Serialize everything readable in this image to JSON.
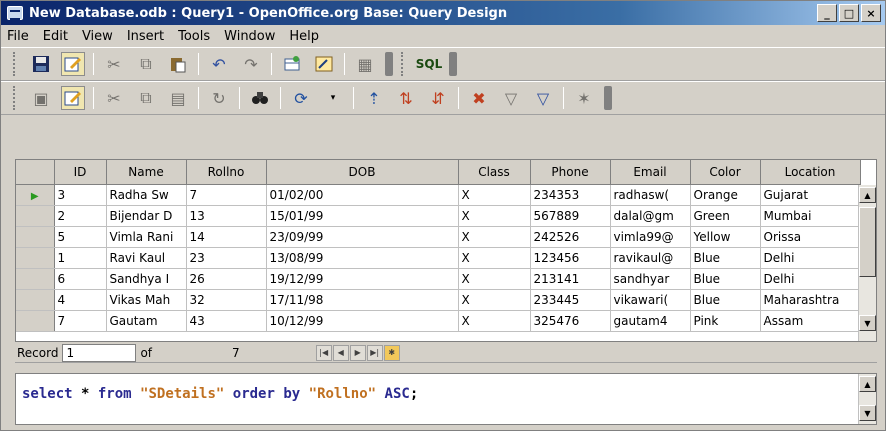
{
  "window": {
    "title": "New Database.odb : Query1 - OpenOffice.org Base: Query Design",
    "buttons": {
      "minimize": "_",
      "maximize": "□",
      "close": "×"
    }
  },
  "menu": [
    "File",
    "Edit",
    "View",
    "Insert",
    "Tools",
    "Window",
    "Help"
  ],
  "toolbar1": {
    "sql_label": "SQL"
  },
  "grid": {
    "columns": [
      "ID",
      "Name",
      "Rollno",
      "DOB",
      "Class",
      "Phone",
      "Email",
      "Color",
      "Location"
    ],
    "rows": [
      [
        "3",
        "Radha Sw",
        "7",
        "01/02/00",
        "X",
        "234353",
        "radhasw(",
        "Orange",
        "Gujarat"
      ],
      [
        "2",
        "Bijendar D",
        "13",
        "15/01/99",
        "X",
        "567889",
        "dalal@gm",
        "Green",
        "Mumbai"
      ],
      [
        "5",
        "Vimla Rani",
        "14",
        "23/09/99",
        "X",
        "242526",
        "vimla99@",
        "Yellow",
        "Orissa"
      ],
      [
        "1",
        "Ravi Kaul",
        "23",
        "13/08/99",
        "X",
        "123456",
        "ravikaul@",
        "Blue",
        "Delhi"
      ],
      [
        "6",
        "Sandhya I",
        "26",
        "19/12/99",
        "X",
        "213141",
        "sandhyar",
        "Blue",
        "Delhi"
      ],
      [
        "4",
        "Vikas Mah",
        "32",
        "17/11/98",
        "X",
        "233445",
        "vikawari(",
        "Blue",
        "Maharashtra"
      ],
      [
        "7",
        "Gautam",
        "43",
        "10/12/99",
        "X",
        "325476",
        "gautam4",
        "Pink",
        "Assam"
      ]
    ]
  },
  "navigation": {
    "record_label": "Record",
    "record_value": "1",
    "of_label": "of",
    "total": "7"
  },
  "sql": {
    "kw_select": "select",
    "star": " * ",
    "kw_from": "from",
    "table": "\"SDetails\"",
    "kw_order": "order by",
    "column": "\"Rollno\"",
    "kw_asc": "ASC",
    "end": ";"
  }
}
